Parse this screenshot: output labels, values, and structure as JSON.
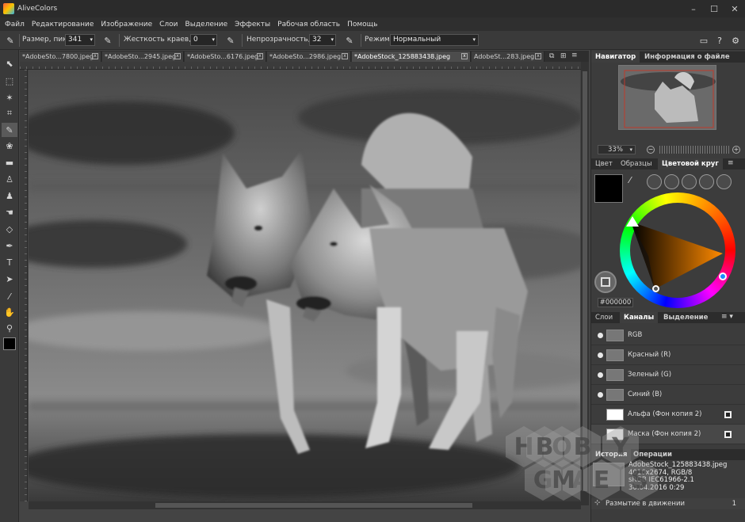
{
  "app": {
    "title": "AliveColors"
  },
  "menu": [
    "Файл",
    "Редактирование",
    "Изображение",
    "Слои",
    "Выделение",
    "Эффекты",
    "Рабочая область",
    "Помощь"
  ],
  "options": {
    "size_label": "Размер, пикс",
    "size_value": "341",
    "hardness_label": "Жесткость краев, %",
    "hardness_value": "0",
    "opacity_label": "Непрозрачность, %",
    "opacity_value": "32",
    "mode_label": "Режим:",
    "mode_value": "Нормальный"
  },
  "tabs": [
    {
      "label": "*AdobeSto...7800.jpeg"
    },
    {
      "label": "*AdobeSto...2945.jpeg"
    },
    {
      "label": "*AdobeSto...6176.jpeg"
    },
    {
      "label": "*AdobeSto...2986.jpeg"
    },
    {
      "label": "*AdobeStock_125883438.jpeg"
    },
    {
      "label": "AdobeSt...283.jpeg"
    }
  ],
  "navigator": {
    "tab_navigator": "Навигатор",
    "tab_info": "Информация о файле",
    "zoom": "33%"
  },
  "color": {
    "tabs": [
      "Цвет",
      "Образцы",
      "Цветовой круг"
    ],
    "hex": "#000000",
    "current": "#000000"
  },
  "layers": {
    "tabs": [
      "Слои",
      "Каналы",
      "Выделение"
    ],
    "items": [
      {
        "name": "RGB"
      },
      {
        "name": "Красный (R)"
      },
      {
        "name": "Зеленый (G)"
      },
      {
        "name": "Синий (B)"
      },
      {
        "name": "Альфа (Фон копия 2)"
      },
      {
        "name": "Маска (Фон копия 2)"
      }
    ]
  },
  "history": {
    "tabs": [
      "История",
      "Операции"
    ],
    "file_name": "AdobeStock_125883438.jpeg",
    "file_dims": "4016x2674, RGB/8",
    "file_profile": "sRGB IEC61966-2.1",
    "file_date": "30.04.2016 0:29",
    "step": "Размытие в движении",
    "step_count": "1"
  },
  "watermark": {
    "row1": [
      "H",
      "O",
      "B",
      "B",
      "Y"
    ],
    "row2": [
      "G",
      "A",
      "M",
      "E",
      "S"
    ]
  }
}
